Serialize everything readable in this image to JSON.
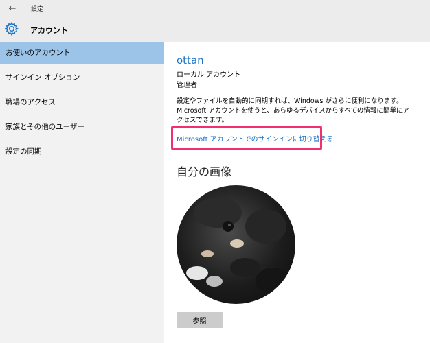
{
  "window": {
    "title": "設定",
    "back_icon": "←"
  },
  "header": {
    "title": "アカウント",
    "icon": "gear-icon"
  },
  "sidebar": {
    "items": [
      {
        "label": "お使いのアカウント",
        "active": true
      },
      {
        "label": "サインイン オプション",
        "active": false
      },
      {
        "label": "職場のアクセス",
        "active": false
      },
      {
        "label": "家族とその他のユーザー",
        "active": false
      },
      {
        "label": "設定の同期",
        "active": false
      }
    ]
  },
  "account": {
    "username": "ottan",
    "type": "ローカル アカウント",
    "role": "管理者",
    "description": "設定やファイルを自動的に同期すれば、Windows がさらに便利になります。Microsoft アカウントを使うと、あらゆるデバイスからすべての情報に簡単にアクセスできます。",
    "switch_link": "Microsoft アカウントでのサインインに切り替える"
  },
  "picture": {
    "heading": "自分の画像",
    "browse_label": "参照"
  },
  "colors": {
    "accent": "#1a72c4",
    "active_item": "#9bc4e8",
    "highlight_border": "#f0306f"
  }
}
